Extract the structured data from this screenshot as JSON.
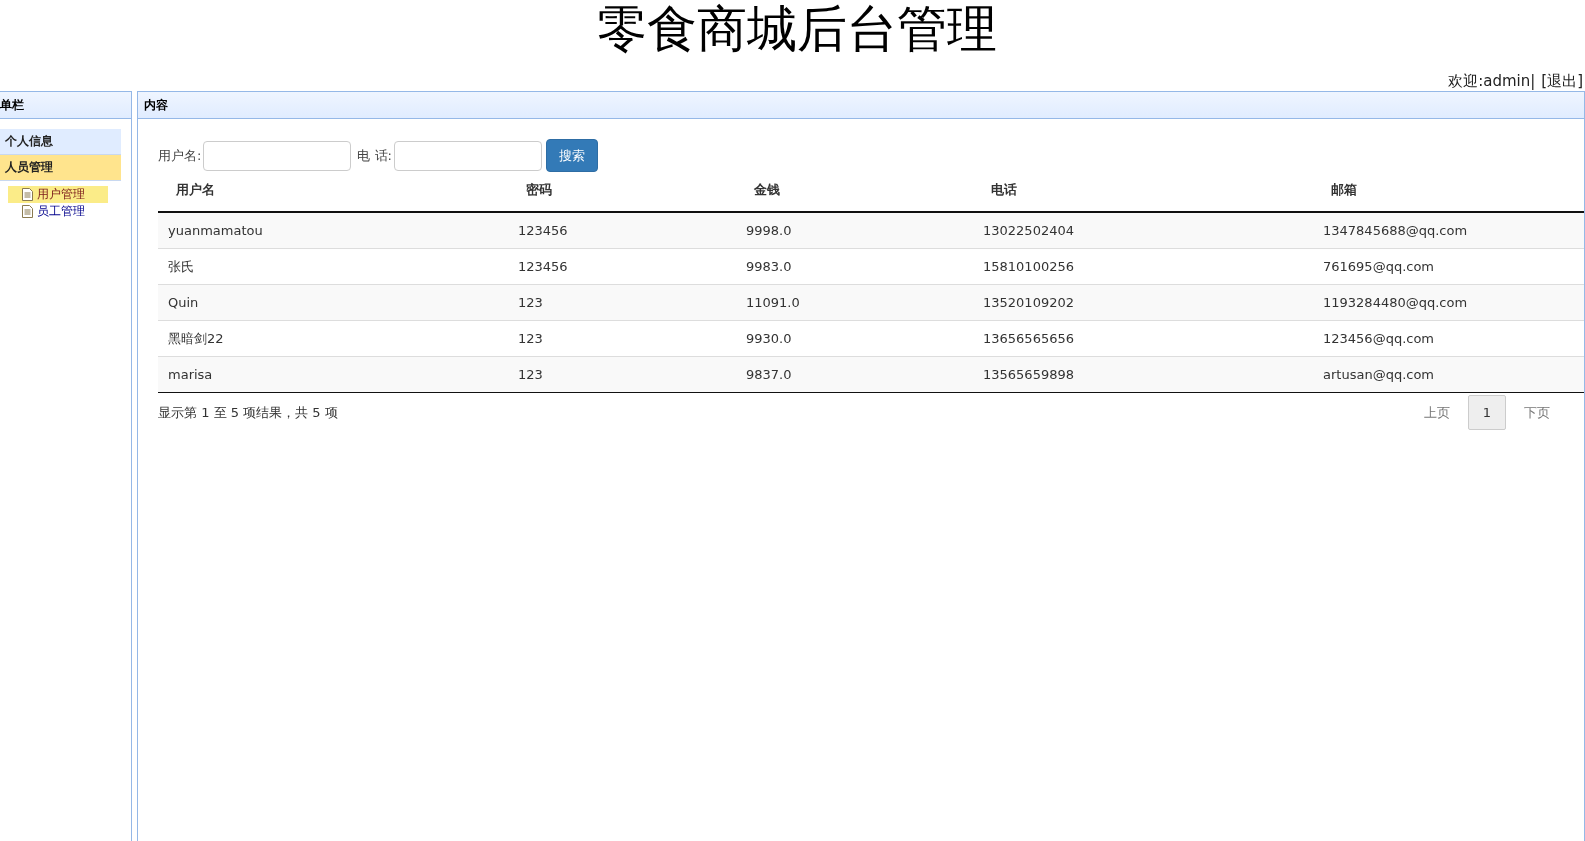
{
  "header": {
    "title": "零食商城后台管理",
    "welcome": "欢迎:admin|",
    "logout": "[退出]"
  },
  "sidebar": {
    "title": "单栏",
    "sections": [
      {
        "label": "个人信息",
        "expanded": false
      },
      {
        "label": "人员管理",
        "expanded": true,
        "children": [
          {
            "label": "用户管理",
            "selected": true
          },
          {
            "label": "员工管理",
            "selected": false
          }
        ]
      }
    ]
  },
  "content": {
    "title": "内容",
    "search": {
      "username_label": "用户名:",
      "phone_label": "电 话:",
      "button": "搜索"
    },
    "table": {
      "columns": [
        "用户名",
        "密码",
        "金钱",
        "电话",
        "邮箱"
      ],
      "rows": [
        [
          "yuanmamatou",
          "123456",
          "9998.0",
          "13022502404",
          "1347845688@qq.com"
        ],
        [
          "张氏",
          "123456",
          "9983.0",
          "15810100256",
          "761695@qq.com"
        ],
        [
          "Quin",
          "123",
          "11091.0",
          "13520109202",
          "1193284480@qq.com"
        ],
        [
          "黑暗剑22",
          "123",
          "9930.0",
          "13656565656",
          "123456@qq.com"
        ],
        [
          "marisa",
          "123",
          "9837.0",
          "13565659898",
          "artusan@qq.com"
        ]
      ]
    },
    "info": "显示第 1 至 5 项结果，共 5 项",
    "pagination": {
      "prev": "上页",
      "pages": [
        {
          "label": "1",
          "selected": true
        }
      ],
      "next": "下页"
    }
  }
}
